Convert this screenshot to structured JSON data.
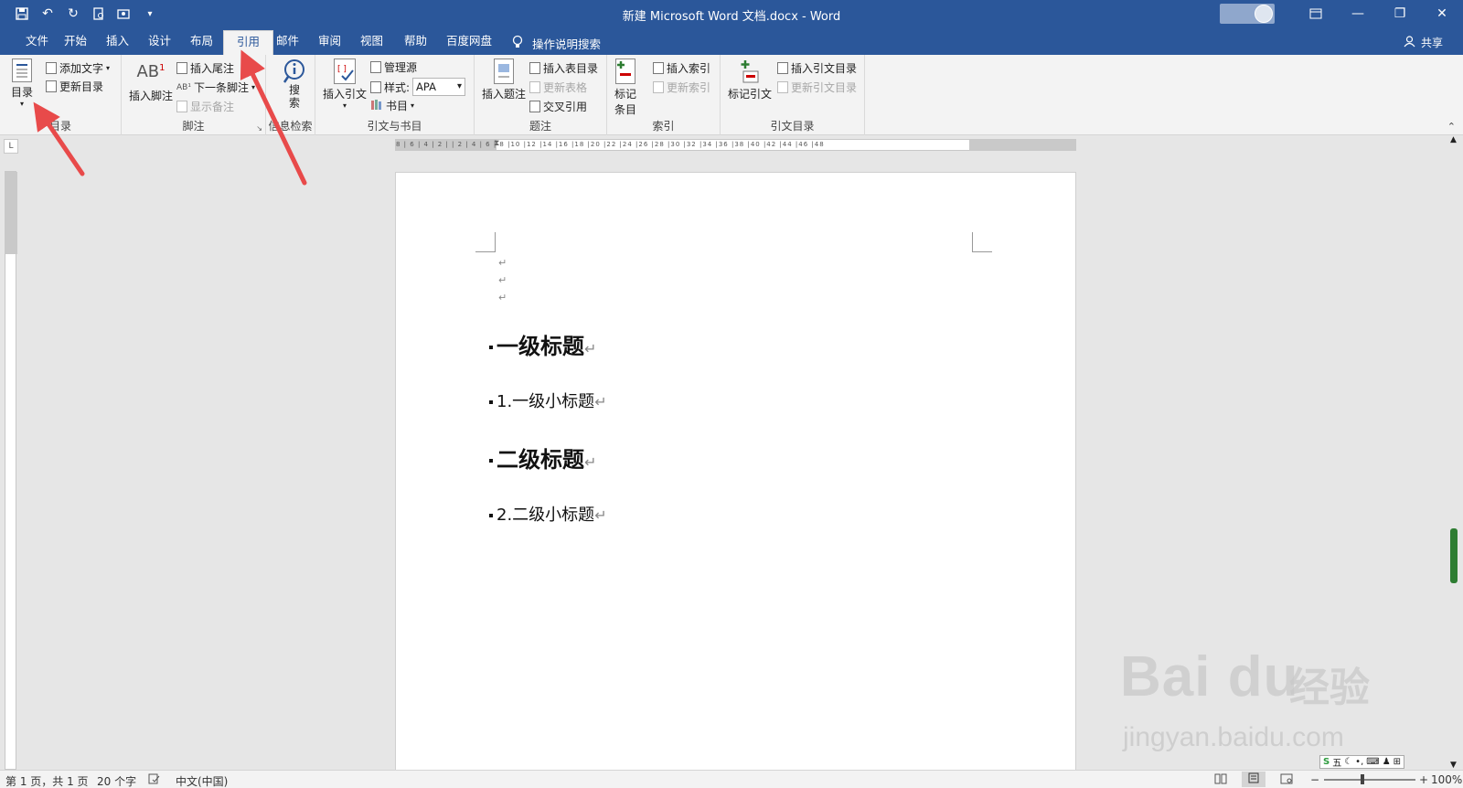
{
  "titlebar": {
    "title": "新建 Microsoft Word 文档.docx  -  Word",
    "qat": {
      "save_icon": "save-icon",
      "undo_icon": "undo-icon",
      "redo_icon": "redo-icon",
      "print_preview_icon": "print-preview-icon",
      "customize_icon": "customize-icon"
    }
  },
  "tabs": [
    {
      "label": "文件"
    },
    {
      "label": "开始"
    },
    {
      "label": "插入"
    },
    {
      "label": "设计"
    },
    {
      "label": "布局"
    },
    {
      "label": "引用"
    },
    {
      "label": "邮件"
    },
    {
      "label": "审阅"
    },
    {
      "label": "视图"
    },
    {
      "label": "帮助"
    },
    {
      "label": "百度网盘"
    }
  ],
  "active_tab": "引用",
  "tell_me": "操作说明搜索",
  "share": "共享",
  "ribbon": {
    "toc_group": {
      "label": "目录",
      "toc_button": "目录",
      "add_text": "添加文字",
      "update_toc": "更新目录"
    },
    "footnote_group": {
      "label": "脚注",
      "insert_footnote": "插入脚注",
      "insert_endnote": "插入尾注",
      "next_footnote": "下一条脚注",
      "show_notes": "显示备注"
    },
    "research_group": {
      "label": "信息检索",
      "search_button": "搜索"
    },
    "citations_group": {
      "label": "引文与书目",
      "insert_citation": "插入引文",
      "manage_sources": "管理源",
      "style_label": "样式:",
      "style_value": "APA",
      "bibliography": "书目"
    },
    "captions_group": {
      "label": "题注",
      "insert_caption": "插入题注",
      "insert_table_of_figures": "插入表目录",
      "update_table": "更新表格",
      "cross_reference": "交叉引用"
    },
    "index_group": {
      "label": "索引",
      "mark_entry_line1": "标记",
      "mark_entry_line2": "条目",
      "insert_index": "插入索引",
      "update_index": "更新索引"
    },
    "toa_group": {
      "label": "引文目录",
      "mark_citation": "标记引文",
      "insert_toa": "插入引文目录",
      "update_toa": "更新引文目录"
    }
  },
  "ruler": {
    "ticks": "8 | 6 | 4 | 2 |   | 2 | 4 | 6 | 8 |10 |12 |14 |16 |18 |20 |22 |24 |26 |28 |30 |32 |34 |36 |38 |40 |42 |44 |46 |48"
  },
  "document": {
    "return_mark": "↵",
    "headings": [
      {
        "level": 1,
        "text": "一级标题"
      },
      {
        "level": 2,
        "text": "1.一级小标题"
      },
      {
        "level": 1,
        "text": "二级标题"
      },
      {
        "level": 2,
        "text": "2.二级小标题"
      }
    ]
  },
  "statusbar": {
    "page_info": "第 1 页，共 1 页",
    "word_count": "20 个字",
    "language": "中文(中国)",
    "zoom": "100%"
  },
  "watermark": {
    "brand": "Bai du",
    "brand_cn": "经验",
    "url": "jingyan.baidu.com"
  },
  "ime": {
    "label": "五"
  },
  "colors": {
    "accent": "#2b579a",
    "arrow": "#e84a4a"
  }
}
